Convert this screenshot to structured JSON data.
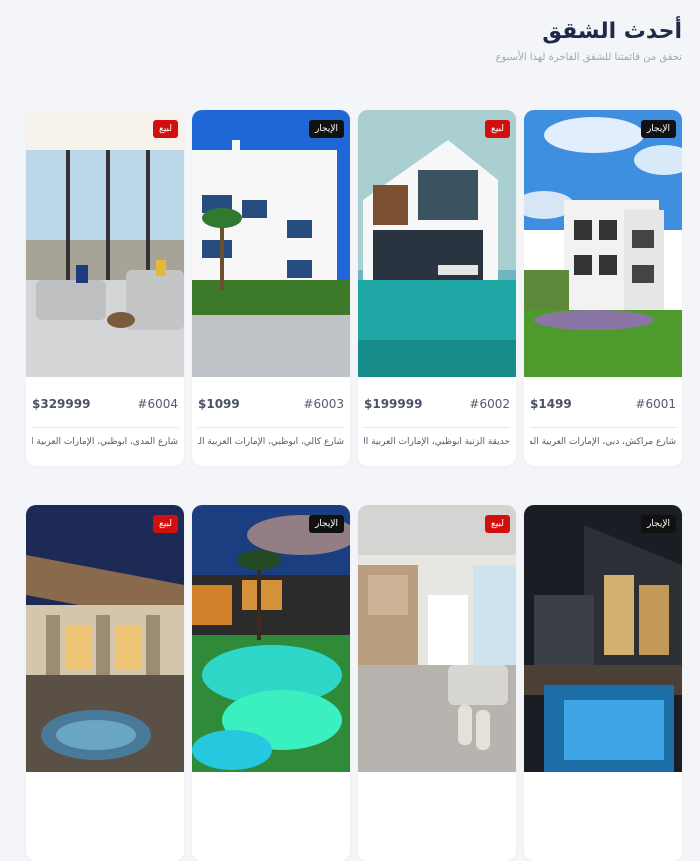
{
  "header": {
    "title": "أحدث الشقق",
    "subtitle": "تحقق من قائمتنا للشقق الفاخرة لهذا الأسبوع"
  },
  "colors": {
    "sale_badge": "#d10f0f",
    "rent_badge": "#111111",
    "title": "#1f2a4a"
  },
  "listings": [
    {
      "id": "#6001",
      "price": "$1499",
      "badge": "الإيجار",
      "badge_type": "rent",
      "address": "شارع مراكش، دبي، الإمارات العربية المتحدة"
    },
    {
      "id": "#6002",
      "price": "$199999",
      "badge": "لبيع",
      "badge_type": "sale",
      "address": "حديقة الزنبة أبوظبي، الإمارات العربية المتحدة"
    },
    {
      "id": "#6003",
      "price": "$1099",
      "badge": "الإيجار",
      "badge_type": "rent",
      "address": "شارع كالي، أبوظبي، الإمارات العربية المتحدة"
    },
    {
      "id": "#6004",
      "price": "$329999",
      "badge": "لبيع",
      "badge_type": "sale",
      "address": "شارع المدى، أبوظبي، الإمارات العربية المتحدة"
    },
    {
      "badge": "الإيجار",
      "badge_type": "rent"
    },
    {
      "badge": "لبيع",
      "badge_type": "sale"
    },
    {
      "badge": "الإيجار",
      "badge_type": "rent"
    },
    {
      "badge": "لبيع",
      "badge_type": "sale"
    }
  ]
}
